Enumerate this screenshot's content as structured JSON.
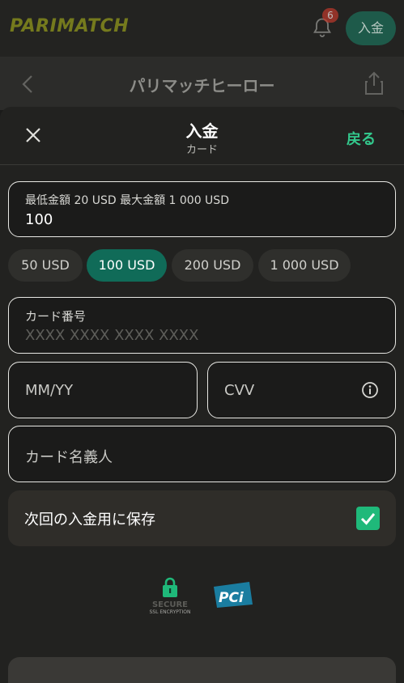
{
  "topbar": {
    "logo": "PARIMATCH",
    "notification_count": "6",
    "deposit_label": "入金"
  },
  "subbar": {
    "title": "パリマッチヒーロー"
  },
  "sheet": {
    "title": "入金",
    "subtitle": "カード",
    "back_label": "戻る"
  },
  "amount": {
    "label": "最低金額 20 USD 最大金額 1 000 USD",
    "value": "100"
  },
  "quick_amounts": [
    {
      "label": "50 USD",
      "selected": false
    },
    {
      "label": "100 USD",
      "selected": true
    },
    {
      "label": "200 USD",
      "selected": false
    },
    {
      "label": "1 000 USD",
      "selected": false
    }
  ],
  "card_number": {
    "label": "カード番号",
    "placeholder": "XXXX XXXX XXXX XXXX"
  },
  "expiry": {
    "placeholder": "MM/YY"
  },
  "cvv": {
    "placeholder": "CVV"
  },
  "card_holder": {
    "placeholder": "カード名義人"
  },
  "save_card": {
    "label": "次回の入金用に保存",
    "checked": true
  },
  "badges": {
    "secure_line1": "SECURE",
    "secure_line2": "SSL ENCRYPTION",
    "pci": "PCi"
  },
  "colors": {
    "accent_green": "#33c88c",
    "chip_active": "#106b58",
    "checkbox": "#1fb97a",
    "logo_yellow": "#b8c21a"
  }
}
